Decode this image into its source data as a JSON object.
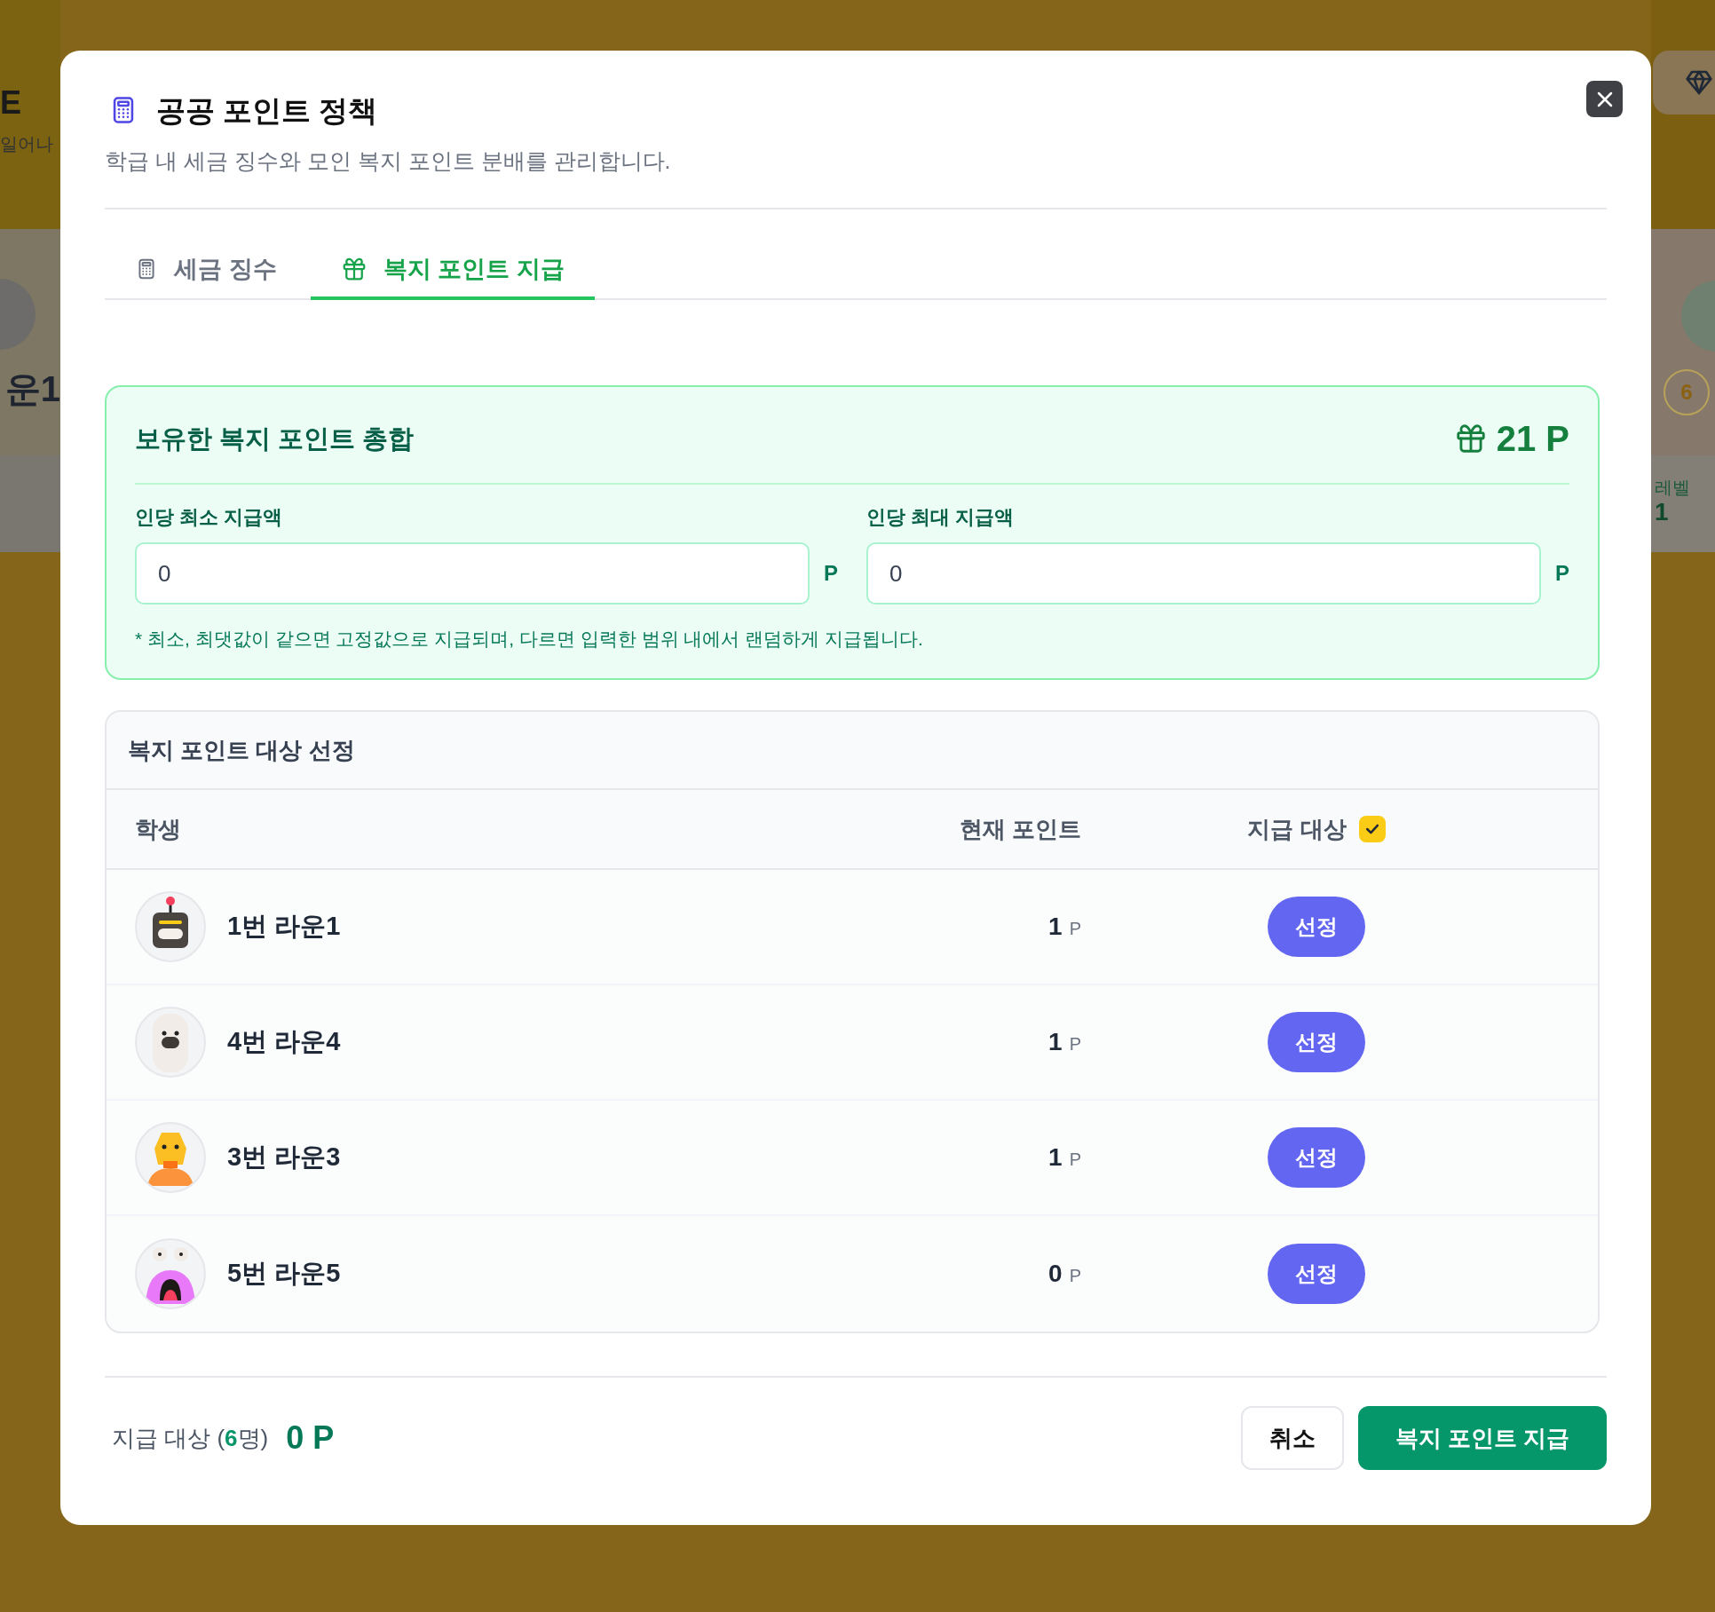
{
  "background": {
    "left": {
      "title": "E",
      "subtitle": "일어나",
      "card_name": "운1"
    },
    "right": {
      "badge": "6",
      "level_label": "레벨",
      "level_value": "1"
    }
  },
  "dialog": {
    "title": "공공 포인트 정책",
    "subtitle": "학급 내 세금 징수와 모인 복지 포인트 분배를 관리합니다."
  },
  "tabs": [
    {
      "label": "세금 징수",
      "kind": "calculator",
      "selected": false
    },
    {
      "label": "복지 포인트 지급",
      "kind": "gift",
      "selected": true
    }
  ],
  "summary": {
    "title": "보유한 복지 포인트 총합",
    "total": "21 P",
    "fields": [
      {
        "label": "인당 최소 지급액",
        "value": "0",
        "unit": "P"
      },
      {
        "label": "인당 최대 지급액",
        "value": "0",
        "unit": "P"
      }
    ],
    "note": "* 최소, 최댓값이 같으면 고정값으로 지급되며, 다르면 입력한 범위 내에서 랜덤하게 지급됩니다."
  },
  "table": {
    "title": "복지 포인트 대상 선정",
    "columns": [
      "학생",
      "현재 포인트",
      "지급 대상"
    ],
    "select_all_checked": true,
    "rows": [
      {
        "name": "1번 라운1",
        "kind": "robot",
        "points": "1",
        "unit": "P",
        "button": "선정"
      },
      {
        "name": "4번 라운4",
        "kind": "ghost",
        "points": "1",
        "unit": "P",
        "button": "선정"
      },
      {
        "name": "3번 라운3",
        "kind": "chick",
        "points": "1",
        "unit": "P",
        "button": "선정"
      },
      {
        "name": "5번 라운5",
        "kind": "monster",
        "points": "0",
        "unit": "P",
        "button": "선정"
      }
    ]
  },
  "footer": {
    "label_prefix": "지급 대상 (",
    "count": "6",
    "label_suffix": "명)",
    "total": "0 P",
    "cancel": "취소",
    "submit": "복지 포인트 지급"
  }
}
